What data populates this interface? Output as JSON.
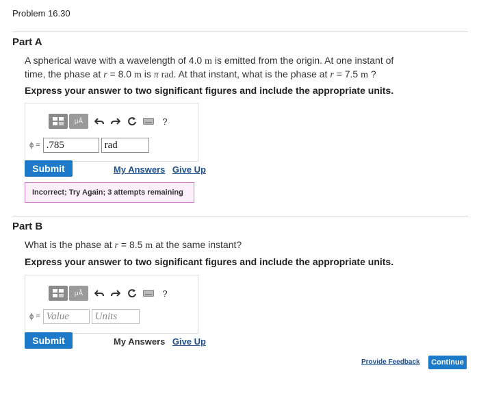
{
  "problem": {
    "title": "Problem 16.30"
  },
  "partA": {
    "title": "Part A",
    "question": {
      "t1": "A spherical wave with a wavelength of 4.0 ",
      "u1": "m",
      "t2": " is emitted from the origin. At one instant of",
      "t3": "time, the phase at ",
      "v1": "r",
      "t4": " = 8.0 ",
      "u2": "m",
      "t5": " is ",
      "pi": "π",
      "t6": " ",
      "u3": "rad",
      "t7": ". At that instant, what is the phase at ",
      "v2": "r",
      "t8": " = 7.5 ",
      "u4": "m",
      "t9": " ?"
    },
    "instruction": "Express your answer to two significant figures and include the appropriate units.",
    "symbol": "ϕ =",
    "value": ".785",
    "units": "rad",
    "submit_label": "Submit",
    "my_answers": "My Answers",
    "give_up": "Give Up",
    "feedback": "Incorrect; Try Again; 3 attempts remaining"
  },
  "partB": {
    "title": "Part B",
    "question": {
      "t1": "What is the phase at ",
      "v1": "r",
      "t2": " = 8.5 ",
      "u1": "m",
      "t3": " at the same instant?"
    },
    "instruction": "Express your answer to two significant figures and include the appropriate units.",
    "symbol": "ϕ =",
    "value_placeholder": "Value",
    "units_placeholder": "Units",
    "submit_label": "Submit",
    "my_answers": "My Answers",
    "give_up": "Give Up"
  },
  "toolbar": {
    "mu_label": "μÅ",
    "help": "?"
  },
  "footer": {
    "feedback_link": "Provide Feedback",
    "continue_label": "Continue"
  },
  "colors": {
    "accent": "#1d79c9",
    "feedback_border": "#d47ac6",
    "feedback_bg": "#fdf0fb"
  }
}
